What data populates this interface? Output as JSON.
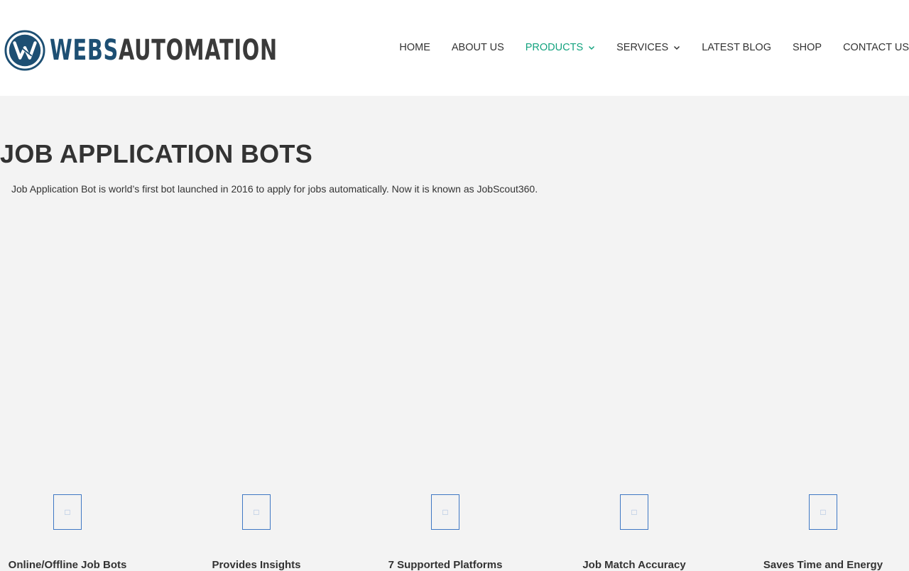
{
  "brand": {
    "logo_part1": "WEBS",
    "logo_part2": "AUTOMATION",
    "primary_color": "#1d4f73",
    "secondary_color": "#3a3a3a"
  },
  "nav": {
    "items": [
      {
        "label": "HOME",
        "has_dropdown": false,
        "active": false
      },
      {
        "label": "ABOUT US",
        "has_dropdown": false,
        "active": false
      },
      {
        "label": "PRODUCTS",
        "has_dropdown": true,
        "active": true
      },
      {
        "label": "SERVICES",
        "has_dropdown": true,
        "active": false
      },
      {
        "label": "LATEST BLOG",
        "has_dropdown": false,
        "active": false
      },
      {
        "label": "SHOP",
        "has_dropdown": false,
        "active": false
      },
      {
        "label": "CONTACT US",
        "has_dropdown": false,
        "active": false
      }
    ],
    "active_color": "#14a37f"
  },
  "main": {
    "title": "JOB APPLICATION BOTS",
    "description": "Job Application Bot is world’s first bot launched in 2016 to apply for jobs automatically. Now it is known as JobScout360."
  },
  "features": [
    {
      "label": "Online/Offline Job Bots",
      "icon": "feature-icon"
    },
    {
      "label": "Provides Insights",
      "icon": "feature-icon"
    },
    {
      "label": "7 Supported Platforms",
      "icon": "feature-icon"
    },
    {
      "label": "Job Match Accuracy",
      "icon": "feature-icon"
    },
    {
      "label": "Saves Time and Energy",
      "icon": "feature-icon"
    }
  ],
  "colors": {
    "background": "#f3f3f3",
    "icon_border": "#3f78c4"
  }
}
